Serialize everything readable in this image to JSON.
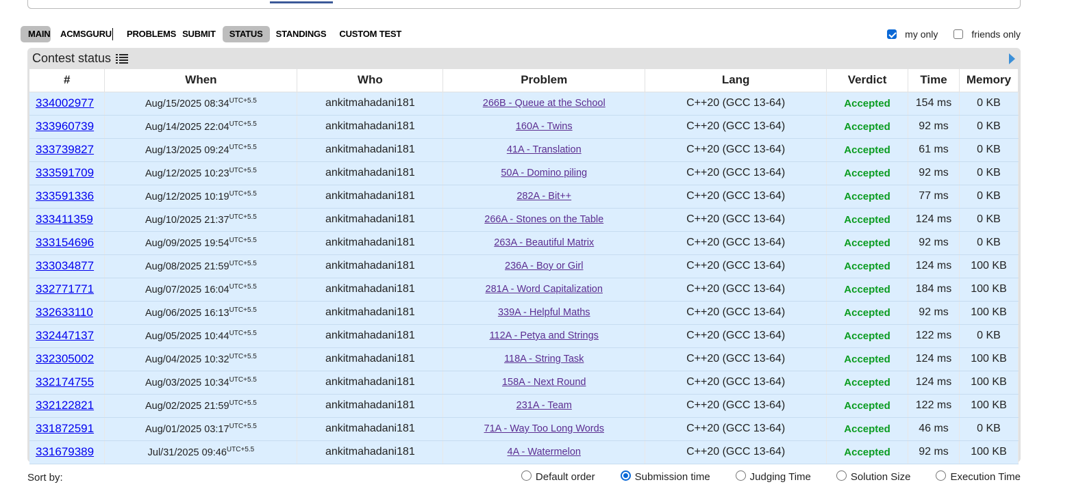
{
  "menu": {
    "items": [
      "MAIN",
      "ACMSGURU",
      "PROBLEMS",
      "SUBMIT",
      "STATUS",
      "STANDINGS",
      "CUSTOM TEST"
    ],
    "active": [
      "MAIN",
      "STATUS"
    ]
  },
  "filters": {
    "my_only": {
      "label": "my only",
      "checked": true
    },
    "friends_only": {
      "label": "friends only",
      "checked": false
    }
  },
  "panel": {
    "title": "Contest status"
  },
  "table": {
    "headers": {
      "id": "#",
      "when": "When",
      "who": "Who",
      "problem": "Problem",
      "lang": "Lang",
      "verdict": "Verdict",
      "time": "Time",
      "memory": "Memory"
    },
    "rows": [
      {
        "id": "334002977",
        "when": "Aug/15/2025 08:34",
        "tz": "UTC+5.5",
        "who": "ankitmahadani181",
        "problem": "266B - Queue at the School",
        "lang": "C++20 (GCC 13-64)",
        "verdict": "Accepted",
        "time": "154 ms",
        "memory": "0 KB"
      },
      {
        "id": "333960739",
        "when": "Aug/14/2025 22:04",
        "tz": "UTC+5.5",
        "who": "ankitmahadani181",
        "problem": "160A - Twins",
        "lang": "C++20 (GCC 13-64)",
        "verdict": "Accepted",
        "time": "92 ms",
        "memory": "0 KB"
      },
      {
        "id": "333739827",
        "when": "Aug/13/2025 09:24",
        "tz": "UTC+5.5",
        "who": "ankitmahadani181",
        "problem": "41A - Translation",
        "lang": "C++20 (GCC 13-64)",
        "verdict": "Accepted",
        "time": "61 ms",
        "memory": "0 KB"
      },
      {
        "id": "333591709",
        "when": "Aug/12/2025 10:23",
        "tz": "UTC+5.5",
        "who": "ankitmahadani181",
        "problem": "50A - Domino piling",
        "lang": "C++20 (GCC 13-64)",
        "verdict": "Accepted",
        "time": "92 ms",
        "memory": "0 KB"
      },
      {
        "id": "333591336",
        "when": "Aug/12/2025 10:19",
        "tz": "UTC+5.5",
        "who": "ankitmahadani181",
        "problem": "282A - Bit++",
        "lang": "C++20 (GCC 13-64)",
        "verdict": "Accepted",
        "time": "77 ms",
        "memory": "0 KB"
      },
      {
        "id": "333411359",
        "when": "Aug/10/2025 21:37",
        "tz": "UTC+5.5",
        "who": "ankitmahadani181",
        "problem": "266A - Stones on the Table",
        "lang": "C++20 (GCC 13-64)",
        "verdict": "Accepted",
        "time": "124 ms",
        "memory": "0 KB"
      },
      {
        "id": "333154696",
        "when": "Aug/09/2025 19:54",
        "tz": "UTC+5.5",
        "who": "ankitmahadani181",
        "problem": "263A - Beautiful Matrix",
        "lang": "C++20 (GCC 13-64)",
        "verdict": "Accepted",
        "time": "92 ms",
        "memory": "0 KB"
      },
      {
        "id": "333034877",
        "when": "Aug/08/2025 21:59",
        "tz": "UTC+5.5",
        "who": "ankitmahadani181",
        "problem": "236A - Boy or Girl",
        "lang": "C++20 (GCC 13-64)",
        "verdict": "Accepted",
        "time": "124 ms",
        "memory": "100 KB"
      },
      {
        "id": "332771771",
        "when": "Aug/07/2025 16:04",
        "tz": "UTC+5.5",
        "who": "ankitmahadani181",
        "problem": "281A - Word Capitalization",
        "lang": "C++20 (GCC 13-64)",
        "verdict": "Accepted",
        "time": "184 ms",
        "memory": "100 KB"
      },
      {
        "id": "332633110",
        "when": "Aug/06/2025 16:13",
        "tz": "UTC+5.5",
        "who": "ankitmahadani181",
        "problem": "339A - Helpful Maths",
        "lang": "C++20 (GCC 13-64)",
        "verdict": "Accepted",
        "time": "92 ms",
        "memory": "100 KB"
      },
      {
        "id": "332447137",
        "when": "Aug/05/2025 10:44",
        "tz": "UTC+5.5",
        "who": "ankitmahadani181",
        "problem": "112A - Petya and Strings",
        "lang": "C++20 (GCC 13-64)",
        "verdict": "Accepted",
        "time": "122 ms",
        "memory": "0 KB"
      },
      {
        "id": "332305002",
        "when": "Aug/04/2025 10:32",
        "tz": "UTC+5.5",
        "who": "ankitmahadani181",
        "problem": "118A - String Task",
        "lang": "C++20 (GCC 13-64)",
        "verdict": "Accepted",
        "time": "124 ms",
        "memory": "100 KB"
      },
      {
        "id": "332174755",
        "when": "Aug/03/2025 10:34",
        "tz": "UTC+5.5",
        "who": "ankitmahadani181",
        "problem": "158A - Next Round",
        "lang": "C++20 (GCC 13-64)",
        "verdict": "Accepted",
        "time": "124 ms",
        "memory": "100 KB"
      },
      {
        "id": "332122821",
        "when": "Aug/02/2025 21:59",
        "tz": "UTC+5.5",
        "who": "ankitmahadani181",
        "problem": "231A - Team",
        "lang": "C++20 (GCC 13-64)",
        "verdict": "Accepted",
        "time": "122 ms",
        "memory": "100 KB"
      },
      {
        "id": "331872591",
        "when": "Aug/01/2025 03:17",
        "tz": "UTC+5.5",
        "who": "ankitmahadani181",
        "problem": "71A - Way Too Long Words",
        "lang": "C++20 (GCC 13-64)",
        "verdict": "Accepted",
        "time": "46 ms",
        "memory": "0 KB"
      },
      {
        "id": "331679389",
        "when": "Jul/31/2025 09:46",
        "tz": "UTC+5.5",
        "who": "ankitmahadani181",
        "problem": "4A - Watermelon",
        "lang": "C++20 (GCC 13-64)",
        "verdict": "Accepted",
        "time": "92 ms",
        "memory": "100 KB"
      }
    ]
  },
  "sort": {
    "label": "Sort by:",
    "options": [
      "Default order",
      "Submission time",
      "Judging Time",
      "Solution Size",
      "Execution Time"
    ],
    "selected": "Submission time"
  },
  "colors": {
    "verdict_accepted": "#0a9c1f",
    "row_bg": "#dceefe",
    "link": "#0000ee",
    "problem_link": "#5b2d91",
    "active_tab": "#bdbdbd"
  },
  "icons": {
    "title_icon": "list-icon",
    "panel_toggle": "arrow-right-icon"
  }
}
